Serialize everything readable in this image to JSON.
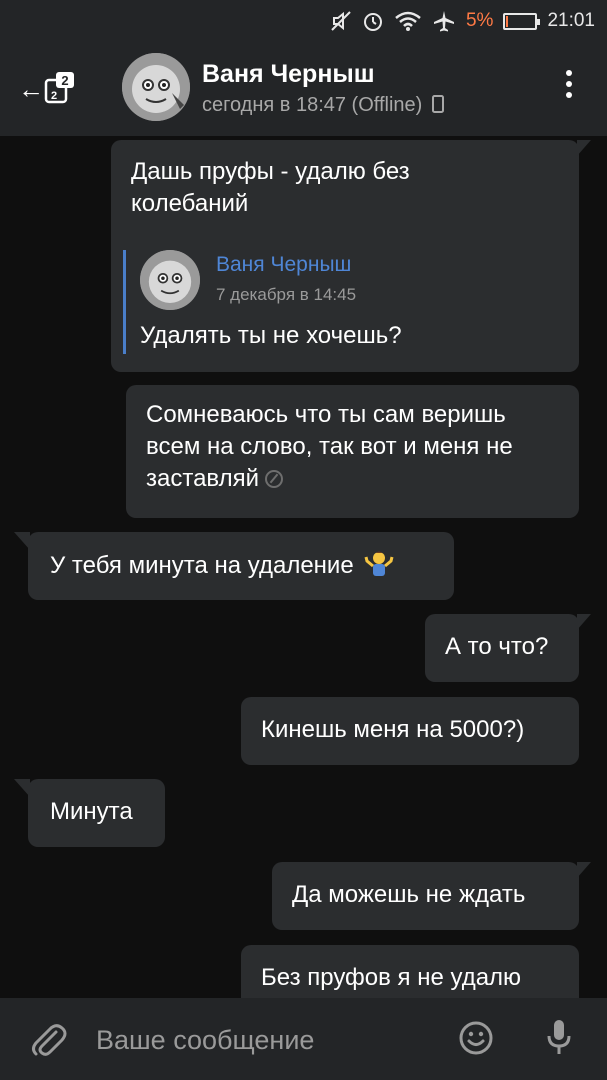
{
  "status_bar": {
    "battery_percent": "5%",
    "time": "21:01",
    "icons": [
      "mute-icon",
      "alarm-icon",
      "wifi-icon",
      "airplane-mode-icon",
      "battery-icon"
    ],
    "battery_level": 0.05
  },
  "header": {
    "back_badge_count": "2",
    "contact_name": "Ваня Черныш",
    "last_seen": "сегодня в 18:47 (Offline)",
    "icons": [
      "back-arrow-icon",
      "phone-device-icon",
      "more-vert-icon"
    ]
  },
  "messages": [
    {
      "direction": "out",
      "text": "Дашь пруфы - удалю без колебаний",
      "reply": {
        "name": "Ваня Черныш",
        "date": "7 декабря в 14:45",
        "text": "Удалять ты не хочешь?"
      }
    },
    {
      "direction": "out",
      "text": "Сомневаюсь что ты сам веришь всем на слово, так вот и меня не заставляй",
      "edited": true
    },
    {
      "direction": "in",
      "text": "У тебя минута на удаление",
      "emoji": "person-shrugging"
    },
    {
      "direction": "out",
      "text": "А то что?"
    },
    {
      "direction": "out",
      "text": "Кинешь меня на 5000?)"
    },
    {
      "direction": "in",
      "text": "Минута"
    },
    {
      "direction": "out",
      "text": "Да можешь не ждать"
    },
    {
      "direction": "out",
      "text": "Без пруфов я не удалю"
    }
  ],
  "input": {
    "placeholder": "Ваше сообщение",
    "icons": [
      "attach-icon",
      "emoji-icon",
      "microphone-icon"
    ]
  },
  "colors": {
    "background": "#0f0f0f",
    "bar": "#232527",
    "bubble": "#2b2d2f",
    "link": "#4f86d6",
    "battery_low": "#ff7a45"
  }
}
